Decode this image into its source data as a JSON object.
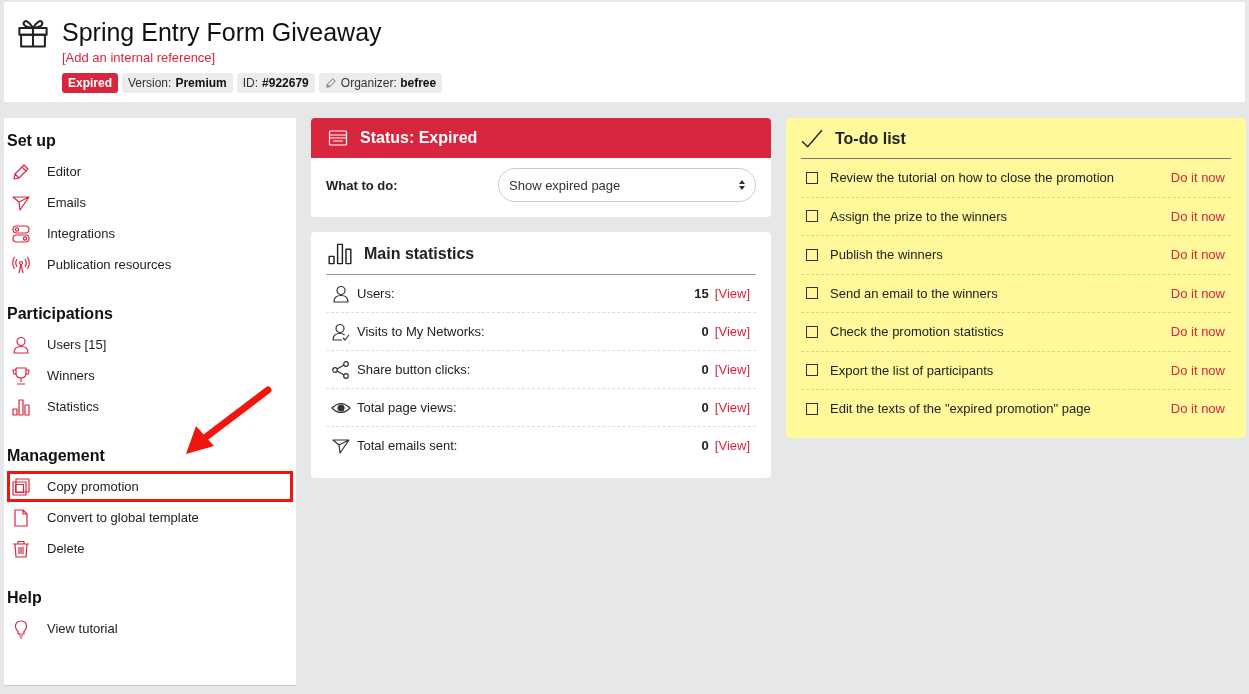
{
  "header": {
    "title": "Spring Entry Form Giveaway",
    "reference_link": "[Add an internal reference]",
    "badges": [
      {
        "kind": "status",
        "text": "Expired"
      },
      {
        "kind": "info",
        "label": "Version:",
        "value": "Premium"
      },
      {
        "kind": "info",
        "label": "ID:",
        "value": "#922679"
      },
      {
        "kind": "editable",
        "label": "Organizer:",
        "value": "befree"
      }
    ]
  },
  "sidebar": {
    "sections": [
      {
        "title": "Set up",
        "items": [
          {
            "label": "Editor",
            "highlighted": false
          },
          {
            "label": "Emails",
            "highlighted": false
          },
          {
            "label": "Integrations",
            "highlighted": false
          },
          {
            "label": "Publication resources",
            "highlighted": false
          }
        ]
      },
      {
        "title": "Participations",
        "items": [
          {
            "label": "Users [15]",
            "highlighted": false
          },
          {
            "label": "Winners",
            "highlighted": false
          },
          {
            "label": "Statistics",
            "highlighted": false
          }
        ]
      },
      {
        "title": "Management",
        "items": [
          {
            "label": "Copy promotion",
            "highlighted": true
          },
          {
            "label": "Convert to global template",
            "highlighted": false
          },
          {
            "label": "Delete",
            "highlighted": false
          }
        ]
      },
      {
        "title": "Help",
        "items": [
          {
            "label": "View tutorial",
            "highlighted": false
          }
        ]
      }
    ]
  },
  "status": {
    "title": "Status: Expired",
    "field_label": "What to do:",
    "select_value": "Show expired page"
  },
  "statistics": {
    "title": "Main statistics",
    "rows": [
      {
        "label": "Users:",
        "value": "15",
        "link": "[View]"
      },
      {
        "label": "Visits to My Networks:",
        "value": "0",
        "link": "[View]"
      },
      {
        "label": "Share button clicks:",
        "value": "0",
        "link": "[View]"
      },
      {
        "label": "Total page views:",
        "value": "0",
        "link": "[View]"
      },
      {
        "label": "Total emails sent:",
        "value": "0",
        "link": "[View]"
      }
    ]
  },
  "todo": {
    "title": "To-do list",
    "items": [
      {
        "text": "Review the tutorial on how to close the promotion",
        "checked": false,
        "action": "Do it now"
      },
      {
        "text": "Assign the prize to the winners",
        "checked": false,
        "action": "Do it now"
      },
      {
        "text": "Publish the winners",
        "checked": false,
        "action": "Do it now"
      },
      {
        "text": "Send an email to the winners",
        "checked": false,
        "action": "Do it now"
      },
      {
        "text": "Check the promotion statistics",
        "checked": false,
        "action": "Do it now"
      },
      {
        "text": "Export the list of participants",
        "checked": false,
        "action": "Do it now"
      },
      {
        "text": "Edit the texts of the \"expired promotion\" page",
        "checked": false,
        "action": "Do it now"
      }
    ]
  }
}
